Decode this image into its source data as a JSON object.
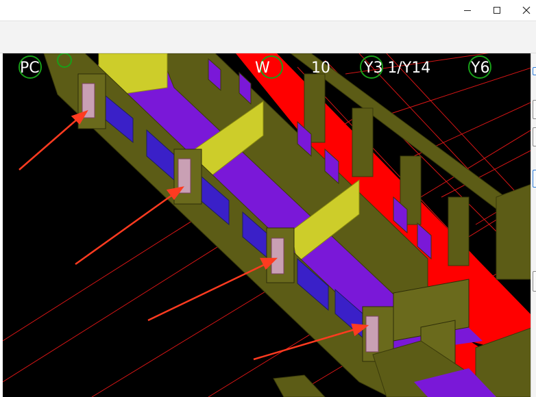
{
  "window": {
    "minimize_icon": "minimize-icon",
    "maximize_icon": "maximize-icon",
    "close_icon": "close-icon"
  },
  "viewport": {
    "background": "#000000",
    "axis_labels": [
      "PC",
      "W",
      "10",
      "Y3 1/Y14",
      "Y6"
    ],
    "colors": {
      "slab": "#7a18d8",
      "wall_yellow": "#cdcd2a",
      "beam_olive": "#5c5c16",
      "hot_red": "#ff0000",
      "grid_red": "#ff1a1a",
      "arrow": "#ff3b20",
      "highlight_column": "#c9a0b4",
      "axis_circle": "#18a018"
    },
    "arrow_count": 4
  }
}
